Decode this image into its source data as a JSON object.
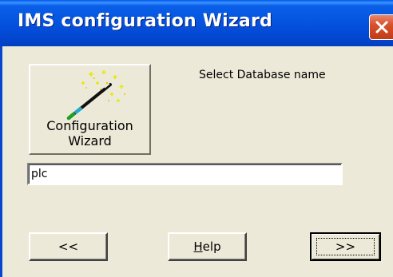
{
  "window": {
    "title": "IMS configuration Wizard"
  },
  "wizard": {
    "label": "Configuration\nWizard",
    "icon": "magic-wand-icon"
  },
  "form": {
    "prompt": "Select Database name",
    "database_value": "plc"
  },
  "buttons": {
    "back_label": "<<",
    "help_mnemonic": "H",
    "help_rest": "elp",
    "next_label": ">>"
  },
  "colors": {
    "titlebar": "#0453de",
    "face": "#ece9d8",
    "close": "#d7512b"
  }
}
